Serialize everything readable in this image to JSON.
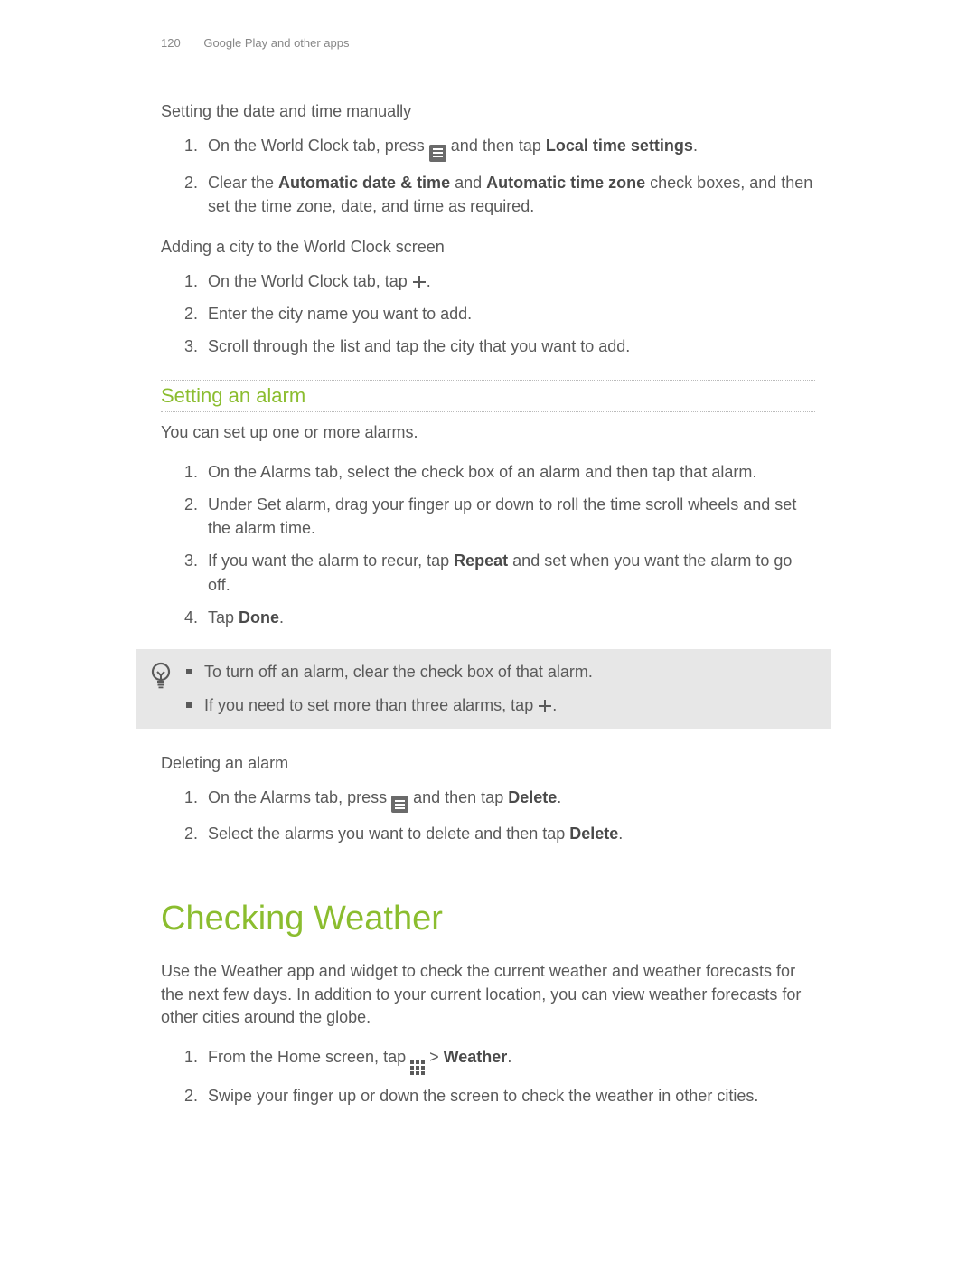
{
  "header": {
    "page_number": "120",
    "chapter": "Google Play and other apps"
  },
  "sec1": {
    "heading": "Setting the date and time manually",
    "steps": [
      {
        "pre": "On the World Clock tab, press ",
        "post": " and then tap ",
        "bold": "Local time settings",
        "tail": "."
      },
      {
        "pre": "Clear the ",
        "bold1": "Automatic date & time",
        "mid": " and ",
        "bold2": "Automatic time zone",
        "tail": " check boxes, and then set the time zone, date, and time as required."
      }
    ]
  },
  "sec2": {
    "heading": "Adding a city to the World Clock screen",
    "step1_pre": "On the World Clock tab, tap ",
    "step1_tail": ".",
    "step2": "Enter the city name you want to add.",
    "step3": "Scroll through the list and tap the city that you want to add."
  },
  "alarm": {
    "title": "Setting an alarm",
    "intro": "You can set up one or more alarms.",
    "step1": "On the Alarms tab, select the check box of an alarm and then tap that alarm.",
    "step2": "Under Set alarm, drag your finger up or down to roll the time scroll wheels and set the alarm time.",
    "step3_pre": "If you want the alarm to recur, tap ",
    "step3_bold": "Repeat",
    "step3_tail": " and set when you want the alarm to go off.",
    "step4_pre": "Tap ",
    "step4_bold": "Done",
    "step4_tail": "."
  },
  "tips": {
    "t1": "To turn off an alarm, clear the check box of that alarm.",
    "t2_pre": "If you need to set more than three alarms, tap ",
    "t2_tail": "."
  },
  "delete": {
    "heading": "Deleting an alarm",
    "s1_pre": "On the Alarms tab, press ",
    "s1_mid": " and then tap ",
    "s1_bold": "Delete",
    "s1_tail": ".",
    "s2_pre": "Select the alarms you want to delete and then tap ",
    "s2_bold": "Delete",
    "s2_tail": "."
  },
  "weather": {
    "title": "Checking Weather",
    "intro": "Use the Weather app and widget to check the current weather and weather forecasts for the next few days. In addition to your current location, you can view weather forecasts for other cities around the globe.",
    "s1_pre": "From the Home screen, tap ",
    "s1_mid": "  > ",
    "s1_bold": "Weather",
    "s1_tail": ".",
    "s2": "Swipe your finger up or down the screen to check the weather in other cities."
  }
}
